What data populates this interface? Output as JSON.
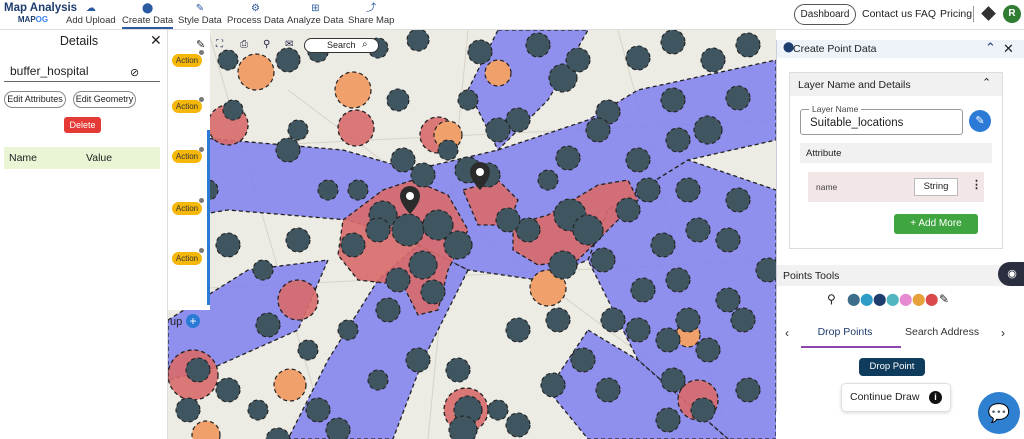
{
  "app": {
    "logo_line1": "Map Analysis",
    "logo_line2_a": "MAP",
    "logo_line2_b": "OG"
  },
  "nav": {
    "items": [
      {
        "label": "Add Upload",
        "icon": "cloud-upload-icon",
        "glyph": "☁"
      },
      {
        "label": "Create Data",
        "icon": "location-pin-icon",
        "glyph": "⬤"
      },
      {
        "label": "Style Data",
        "icon": "paint-icon",
        "glyph": "✎"
      },
      {
        "label": "Process Data",
        "icon": "process-icon",
        "glyph": "⚙"
      },
      {
        "label": "Analyze Data",
        "icon": "analyze-icon",
        "glyph": "⊞"
      },
      {
        "label": "Share Map",
        "icon": "share-icon",
        "glyph": "⤴"
      }
    ],
    "active": "Create Data",
    "dashboard": "Dashboard",
    "contact": "Contact us",
    "faq": "FAQ",
    "pricing": "Pricing",
    "avatar_letter": "R"
  },
  "details": {
    "title": "Details",
    "layer_name": "buffer_hospital",
    "edit_attributes": "Edit Attributes",
    "edit_geometry": "Edit Geometry",
    "delete": "Delete",
    "col_name": "Name",
    "col_value": "Value"
  },
  "action_strip": {
    "labels": [
      "Action",
      "Action",
      "Action",
      "Action",
      "Action"
    ],
    "bottom_text": "up"
  },
  "map_toolbar": {
    "search_label": "Search"
  },
  "create_point": {
    "title": "Create Point Data",
    "section_title": "Layer Name and Details",
    "layer_name_label": "Layer Name",
    "layer_name_value": "Suitable_locations",
    "attribute_header": "Attribute",
    "attribute_name": "name",
    "attribute_type": "String",
    "add_more": "Add More",
    "points_tools": "Points Tools",
    "tab_drop": "Drop Points",
    "tab_search": "Search Address",
    "drop_point_btn": "Drop Point",
    "continue_draw": "Continue Draw"
  },
  "colors": {
    "buffer_blue": "#7f7ff0",
    "hospital_red": "#d86a6a",
    "dark_circle": "#3f5560",
    "orange_circle": "#f0a06a",
    "add_more_green": "#3fa540",
    "delete_red": "#e53935"
  }
}
